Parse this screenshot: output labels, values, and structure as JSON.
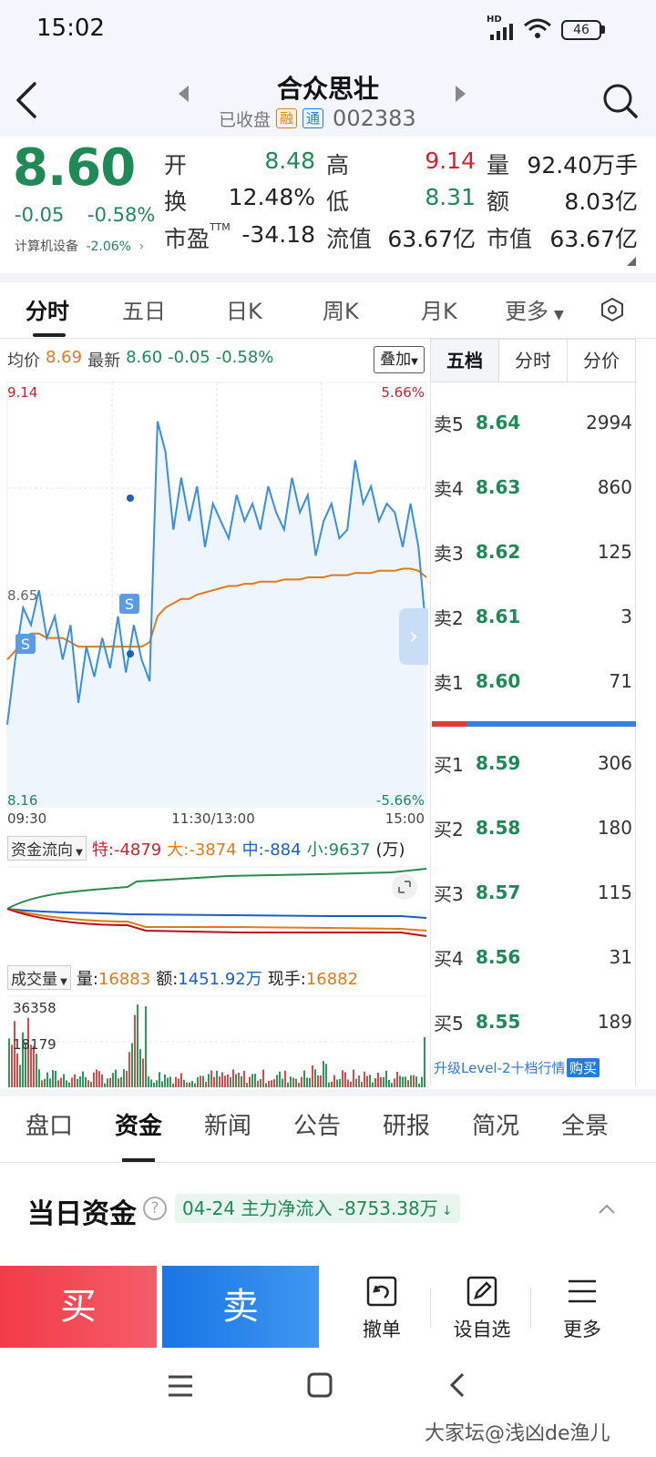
{
  "status_bar": {
    "time": "15:02",
    "network": "HD",
    "battery": "46"
  },
  "header": {
    "stock_name": "合众思壮",
    "status": "已收盘",
    "tag_rong": "融",
    "tag_tong": "通",
    "code": "002383"
  },
  "quote": {
    "price": "8.60",
    "change": "-0.05",
    "change_pct": "-0.58%",
    "industry": "计算机设备",
    "industry_change": "-2.06%",
    "fields": [
      {
        "label": "开",
        "value": "8.48",
        "color": "green"
      },
      {
        "label": "高",
        "value": "9.14",
        "color": "red"
      },
      {
        "label": "量",
        "value": "92.40万手",
        "color": "black"
      },
      {
        "label": "换",
        "value": "12.48%",
        "color": "black"
      },
      {
        "label": "低",
        "value": "8.31",
        "color": "green"
      },
      {
        "label": "额",
        "value": "8.03亿",
        "color": "black"
      },
      {
        "label": "市盈TTM",
        "value": "-34.18",
        "color": "black"
      },
      {
        "label": "流值",
        "value": "63.67亿",
        "color": "black"
      },
      {
        "label": "市值",
        "value": "63.67亿",
        "color": "black"
      }
    ]
  },
  "chart_tabs": [
    "分时",
    "五日",
    "日K",
    "周K",
    "月K",
    "更多"
  ],
  "info_line": {
    "avg_label": "均价",
    "avg": "8.69",
    "latest_label": "最新",
    "latest": "8.60",
    "change": "-0.05",
    "change_pct": "-0.58%",
    "overlay": "叠加"
  },
  "chart_data": {
    "type": "line",
    "ylim": [
      8.16,
      9.14
    ],
    "y_top_label": "9.14",
    "y_mid_label": "8.65",
    "y_bottom_label": "8.16",
    "pct_top": "5.66%",
    "pct_bottom": "-5.66%",
    "x_labels": [
      "09:30",
      "11:30/13:00",
      "15:00"
    ],
    "markers": [
      "S",
      "S"
    ],
    "series": [
      {
        "values": [
          8.35,
          8.5,
          8.62,
          8.58,
          8.66,
          8.55,
          8.6,
          8.5,
          8.58,
          8.4,
          8.53,
          8.46,
          8.55,
          8.48,
          8.6,
          8.47,
          8.58,
          8.5,
          8.45,
          9.05,
          8.98,
          8.8,
          8.92,
          8.82,
          8.9,
          8.76,
          8.86,
          8.82,
          8.78,
          8.88,
          8.82,
          8.86,
          8.8,
          8.9,
          8.84,
          8.8,
          8.92,
          8.84,
          8.88,
          8.74,
          8.82,
          8.86,
          8.78,
          8.8,
          8.96,
          8.86,
          8.9,
          8.82,
          8.86,
          8.84,
          8.76,
          8.86,
          8.76,
          8.56
        ]
      },
      {
        "values": [
          8.5,
          8.52,
          8.55,
          8.56,
          8.56,
          8.55,
          8.55,
          8.55,
          8.54,
          8.53,
          8.53,
          8.53,
          8.53,
          8.53,
          8.53,
          8.53,
          8.53,
          8.53,
          8.54,
          8.6,
          8.62,
          8.63,
          8.64,
          8.64,
          8.65,
          8.655,
          8.66,
          8.665,
          8.67,
          8.67,
          8.675,
          8.675,
          8.68,
          8.68,
          8.68,
          8.685,
          8.685,
          8.685,
          8.69,
          8.69,
          8.69,
          8.695,
          8.695,
          8.695,
          8.7,
          8.7,
          8.7,
          8.705,
          8.705,
          8.705,
          8.71,
          8.71,
          8.705,
          8.69
        ]
      }
    ],
    "colors": {
      "price": "#3a8ee0",
      "avg": "#e07b1a"
    }
  },
  "fund_flow": {
    "title": "资金流向",
    "te_label": "特:",
    "te": "-4879",
    "da_label": "大:",
    "da": "-3874",
    "zhong_label": "中:",
    "zhong": "-884",
    "xiao_label": "小:",
    "xiao": "9637",
    "unit": "(万)"
  },
  "volume_line": {
    "title": "成交量",
    "vol_label": "量:",
    "vol": "16883",
    "amt_label": "额:",
    "amt": "1451.92万",
    "cur_label": "现手:",
    "cur": "16882",
    "y_top": "36358",
    "y_mid": "18179"
  },
  "order_book": {
    "tabs": [
      "五档",
      "分时",
      "分价"
    ],
    "asks": [
      {
        "label": "卖5",
        "price": "8.64",
        "vol": "2994"
      },
      {
        "label": "卖4",
        "price": "8.63",
        "vol": "860"
      },
      {
        "label": "卖3",
        "price": "8.62",
        "vol": "125"
      },
      {
        "label": "卖2",
        "price": "8.61",
        "vol": "3"
      },
      {
        "label": "卖1",
        "price": "8.60",
        "vol": "71"
      }
    ],
    "bids": [
      {
        "label": "买1",
        "price": "8.59",
        "vol": "306"
      },
      {
        "label": "买2",
        "price": "8.58",
        "vol": "180"
      },
      {
        "label": "买3",
        "price": "8.57",
        "vol": "115"
      },
      {
        "label": "买4",
        "price": "8.56",
        "vol": "31"
      },
      {
        "label": "买5",
        "price": "8.55",
        "vol": "189"
      }
    ],
    "upgrade_text": "升级Level-2十档行情",
    "buy_text": "购买"
  },
  "bottom_tabs": [
    "盘口",
    "资金",
    "新闻",
    "公告",
    "研报",
    "简况",
    "全景"
  ],
  "daily_funds": {
    "title": "当日资金",
    "pill": "04-24 主力净流入 -8753.38万"
  },
  "actions": {
    "buy": "买",
    "sell": "卖",
    "cancel": "撤单",
    "watchlist": "设自选",
    "more": "更多"
  },
  "watermark": "大家坛@浅凶de渔儿"
}
